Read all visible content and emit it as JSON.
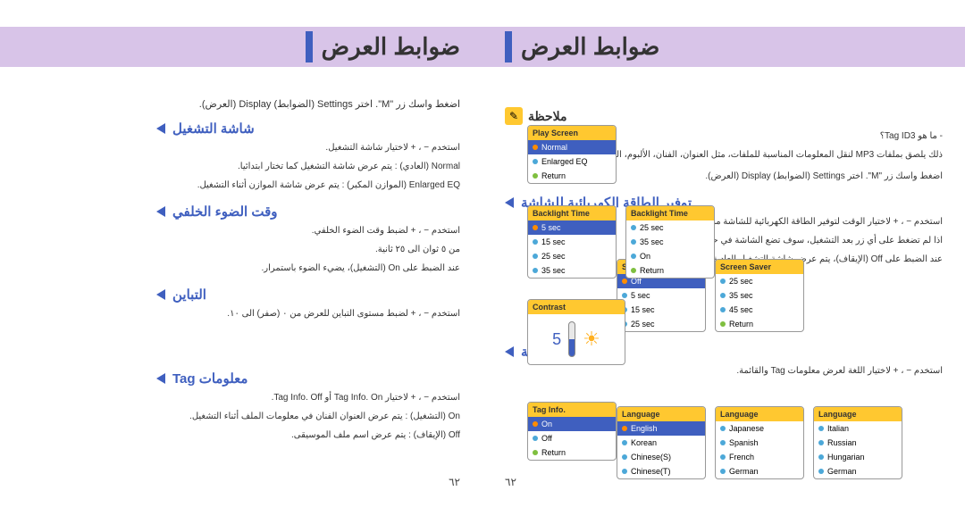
{
  "pageTitle": "ضوابط العرض",
  "pageNum": "٦٢",
  "right": {
    "intro": "اضغط واسك زر \"M\". اختر Settings (الضوابط) Display (العرض).",
    "sections": {
      "playScreen": {
        "title": "شاشة التشغيل",
        "l1": "استخدم  −  ،  +  لاختيار شاشة التشغيل.",
        "l2": "Normal (العادي) : يتم عرض شاشة التشغيل كما تختار ابتدائيا.",
        "l3": "Enlarged EQ (الموازن المكبر) : يتم عرض شاشة الموازن أثناء التشغيل."
      },
      "backlight": {
        "title": "وقت الضوء الخلفي",
        "l1": "استخدم  −  ،  +  لضبط وقت الضوء الخلفي.",
        "l2": "من ٥ ثوان الى ٢٥ ثانية.",
        "l3": "عند الضبط على On (التشغيل)، يضيء الضوء باستمرار."
      },
      "contrast": {
        "title": "التباين",
        "l1": "استخدم  −  ،  +  لضبط مستوى التباين للعرض من ٠ (صفر) الى ١٠."
      },
      "tag": {
        "title": "معلومات Tag",
        "l1": "استخدم  −  ،  +  لاختيار Tag Info. On أو Tag Info. Off.",
        "l2": "On (التشغيل) : يتم عرض العنوان الفنان في معلومات الملف أثناء التشغيل.",
        "l3": "Off (الإيقاف) : يتم عرض اسم ملف الموسيقى."
      }
    },
    "panels": {
      "playScreen": {
        "header": "Play Screen",
        "items": [
          "Normal",
          "Enlarged EQ",
          "Return"
        ]
      },
      "backlight1": {
        "header": "Backlight Time",
        "items": [
          "25 sec",
          "35 sec",
          "On",
          "Return"
        ]
      },
      "backlight2": {
        "header": "Backlight Time",
        "items": [
          "5 sec",
          "15 sec",
          "25 sec",
          "35 sec"
        ]
      },
      "contrast": {
        "header": "Contrast",
        "value": "5"
      },
      "tagInfo": {
        "header": "Tag Info.",
        "items": [
          "On",
          "Off",
          "Return"
        ]
      }
    }
  },
  "left": {
    "noteLabel": "ملاحظة",
    "note1": "- ما هو Tag ID3؟",
    "note2": "ذلك يلصق بملفات MP3 لنقل المعلومات المناسبة للملفات، مثل العنوان، الفنان، الألبوم، السنة، النوع والمذكرة.",
    "intro": "اضغط واسك زر \"M\". اختر Settings (الضوابط) Display (العرض).",
    "sections": {
      "power": {
        "title": "توفير الطاقة الكهربائية للشاشة",
        "l1": "استخدم  −  ،  +  لاختيار الوقت لتوفير الطاقة الكهربائية للشاشة من ٥ ثوان الى ٤٥ ثانية.",
        "l2": "اذا لم تضغط على أي زر بعد التشغيل، سوف تضع الشاشة في حالة توفير الطاقة.",
        "l3": "عند الضبط على Off (الإيقاف)، يتم عرض شاشة التشغيل العادية."
      },
      "language": {
        "title": "اللغة",
        "l1": "استخدم  −  ،  +  لاختيار اللغة لعرض معلومات Tag والقائمة."
      }
    },
    "panels": {
      "saver1": {
        "header": "Screen Saver",
        "items": [
          "25 sec",
          "35 sec",
          "45 sec",
          "Return"
        ]
      },
      "saver2": {
        "header": "Screen Saver",
        "items": [
          "Off",
          "5 sec",
          "15 sec",
          "25 sec"
        ]
      },
      "lang1": {
        "header": "Language",
        "items": [
          "Italian",
          "Russian",
          "Hungarian",
          "German"
        ]
      },
      "lang2": {
        "header": "Language",
        "items": [
          "Japanese",
          "Spanish",
          "French",
          "German"
        ]
      },
      "lang3": {
        "header": "Language",
        "items": [
          "English",
          "Korean",
          "Chinese(S)",
          "Chinese(T)"
        ]
      }
    }
  }
}
